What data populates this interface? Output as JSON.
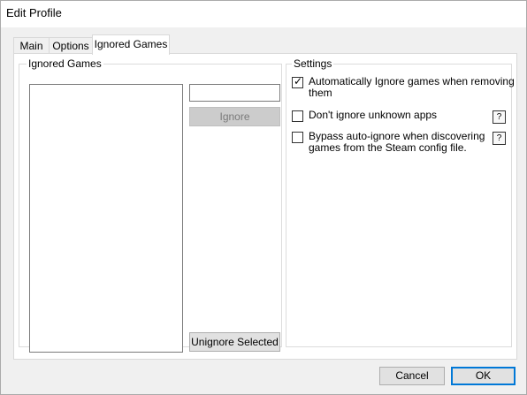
{
  "window": {
    "title": "Edit Profile"
  },
  "tabs": [
    {
      "label": "Main"
    },
    {
      "label": "Options"
    },
    {
      "label": "Ignored Games"
    }
  ],
  "ignored_games": {
    "group_label": "Ignored Games",
    "input_value": "",
    "ignore_button": "Ignore",
    "unignore_button": "Unignore Selected",
    "list_items": []
  },
  "settings": {
    "group_label": "Settings",
    "options": [
      {
        "label_line1": "Automatically Ignore games when removing",
        "label_line2": "them",
        "checked": true
      },
      {
        "label_line1": "Don't ignore unknown apps",
        "label_line2": "",
        "checked": false,
        "help": "?"
      },
      {
        "label_line1": "Bypass auto-ignore when discovering",
        "label_line2": "games from the Steam config file.",
        "checked": false,
        "help": "?"
      }
    ]
  },
  "footer": {
    "cancel_label": "Cancel",
    "ok_label": "OK"
  },
  "colors": {
    "accent": "#0078d7",
    "background": "#f0f0f0"
  }
}
